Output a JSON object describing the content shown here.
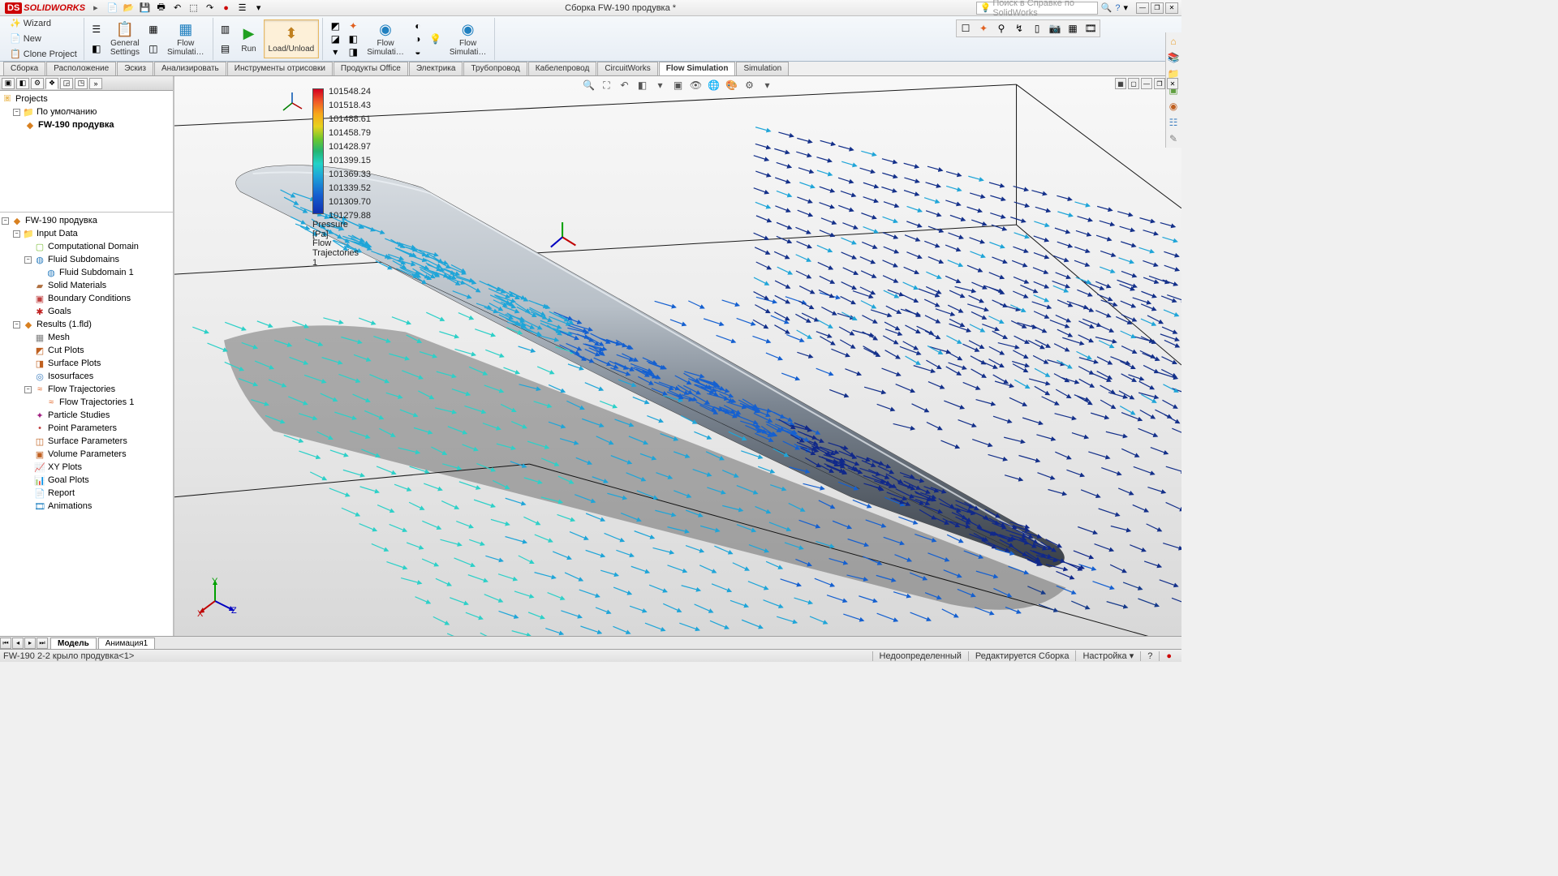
{
  "title_bar": {
    "app": "SOLIDWORKS",
    "doc_title": "Сборка FW-190 продувка *",
    "search_placeholder": "Поиск в Справке по SolidWorks"
  },
  "qat": {
    "new": "new",
    "open": "open",
    "save": "save",
    "print": "print",
    "undo": "undo",
    "select": "select",
    "redo2": "redo",
    "rebuild": "rebuild",
    "options": "options",
    "dropdown": "dropdown"
  },
  "ribbon": {
    "left_items": {
      "wizard": "Wizard",
      "new": "New",
      "clone": "Clone Project"
    },
    "buttons": {
      "general_settings": "General\nSettings",
      "flow_simul1": "Flow\nSimulati…",
      "run": "Run",
      "load_unload": "Load/Unload",
      "flow_simul2": "Flow\nSimulati…",
      "flow_simul3": "Flow\nSimulati…"
    }
  },
  "tabs": {
    "items": [
      "Сборка",
      "Расположение",
      "Эскиз",
      "Анализировать",
      "Инструменты отрисовки",
      "Продукты Office",
      "Электрика",
      "Трубопровод",
      "Кабелепровод",
      "CircuitWorks",
      "Flow Simulation",
      "Simulation"
    ],
    "active": "Flow Simulation"
  },
  "tree_upper": {
    "root": "Projects",
    "default": "По умолчанию",
    "project": "FW-190 продувка"
  },
  "tree_lower": {
    "root": "FW-190 продувка",
    "input": "Input Data",
    "comp_domain": "Computational Domain",
    "fluid_sub": "Fluid Subdomains",
    "fluid_sub1": "Fluid Subdomain 1",
    "solid_mat": "Solid Materials",
    "boundary": "Boundary Conditions",
    "goals": "Goals",
    "results": "Results (1.fld)",
    "mesh": "Mesh",
    "cut_plots": "Cut Plots",
    "surface_plots": "Surface Plots",
    "isosurfaces": "Isosurfaces",
    "flow_traj": "Flow Trajectories",
    "flow_traj1": "Flow Trajectories 1",
    "particle": "Particle Studies",
    "point_param": "Point Parameters",
    "surface_param": "Surface Parameters",
    "volume_param": "Volume Parameters",
    "xy_plots": "XY Plots",
    "goal_plots": "Goal Plots",
    "report": "Report",
    "animations": "Animations"
  },
  "legend": {
    "values": [
      "101548.24",
      "101518.43",
      "101488.61",
      "101458.79",
      "101428.97",
      "101399.15",
      "101369.33",
      "101339.52",
      "101309.70",
      "101279.88"
    ],
    "title": "Pressure [Pa]",
    "subtitle": "Flow Trajectories 1"
  },
  "triad": {
    "x": "X",
    "y": "Y",
    "z": "Z"
  },
  "bottom_tabs": {
    "model": "Модель",
    "anim": "Анимация1"
  },
  "status": {
    "left": "FW-190 2-2 крыло продувка<1>",
    "under": "Недоопределенный",
    "edit": "Редактируется Сборка",
    "custom": "Настройка"
  }
}
